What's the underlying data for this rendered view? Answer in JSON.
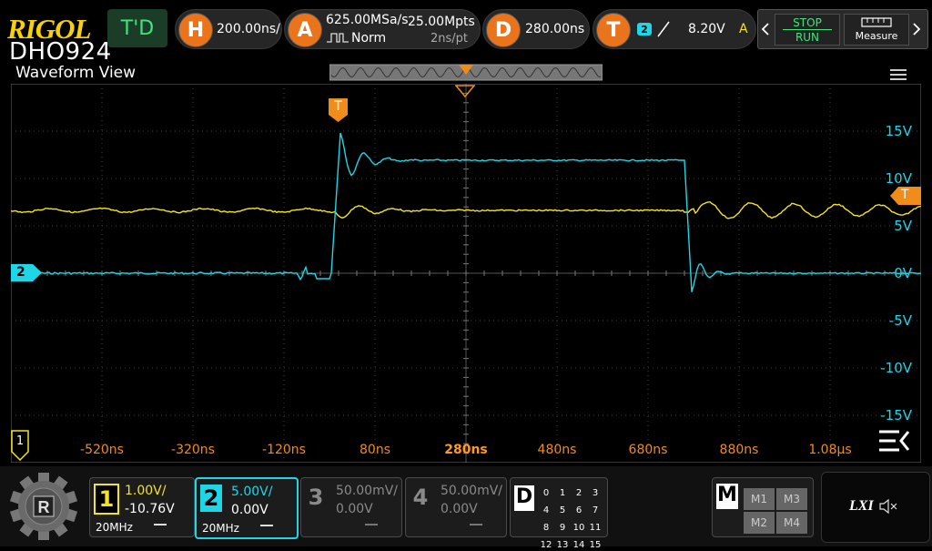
{
  "brand": {
    "logo": "RIGOL",
    "model": "DHO924"
  },
  "view_title": "Waveform View",
  "top_bar": {
    "mode_label": "T'D",
    "horizontal": {
      "key": "H",
      "timebase": "200.00ns/"
    },
    "acquire": {
      "key": "A",
      "sample_rate": "625.00MSa/s",
      "memory_depth": "25.00Mpts",
      "mode": "Norm",
      "resolution": "2ns/pt"
    },
    "delay": {
      "key": "D",
      "value": "280.00ns"
    },
    "trigger": {
      "key": "T",
      "source": "2",
      "level": "8.20V",
      "sweep": "A"
    },
    "run_stop": {
      "stop": "STOP",
      "run": "RUN"
    },
    "measure_label": "Measure"
  },
  "waveform": {
    "trigger_marker": "T",
    "trigger_level_marker": "T",
    "ch2_marker": "2",
    "ch1_marker": "1",
    "y_labels": [
      "15V",
      "10V",
      "5V",
      "0V",
      "-5V",
      "-10V",
      "-15V"
    ],
    "x_labels": [
      "-520ns",
      "-320ns",
      "-120ns",
      "80ns",
      "280ns",
      "480ns",
      "680ns",
      "880ns",
      "1.08µs"
    ]
  },
  "bottom_bar": {
    "channels": [
      {
        "num": "1",
        "scale": "1.00V/",
        "offset": "-10.76V",
        "bw": "20MHz",
        "color": "#f4e41c"
      },
      {
        "num": "2",
        "scale": "5.00V/",
        "offset": "0.00V",
        "bw": "20MHz",
        "color": "#1ed6e6"
      },
      {
        "num": "3",
        "scale": "50.00mV/",
        "offset": "0.00V",
        "bw": "",
        "color": "#8a8a8a"
      },
      {
        "num": "4",
        "scale": "50.00mV/",
        "offset": "0.00V",
        "bw": "",
        "color": "#8a8a8a"
      }
    ],
    "digital": {
      "key": "D",
      "bits": [
        "0",
        "1",
        "2",
        "3",
        "4",
        "5",
        "6",
        "7",
        "8",
        "9",
        "10",
        "11",
        "12",
        "13",
        "14",
        "15"
      ]
    },
    "math": {
      "key": "M",
      "items": [
        "M1",
        "M3",
        "M2",
        "M4"
      ]
    },
    "lxi_label": "LXI"
  },
  "colors": {
    "ch1": "#f4e41c",
    "ch2": "#1ed6e6",
    "accent": "#e9741c",
    "label_orange": "#f08c1a"
  }
}
